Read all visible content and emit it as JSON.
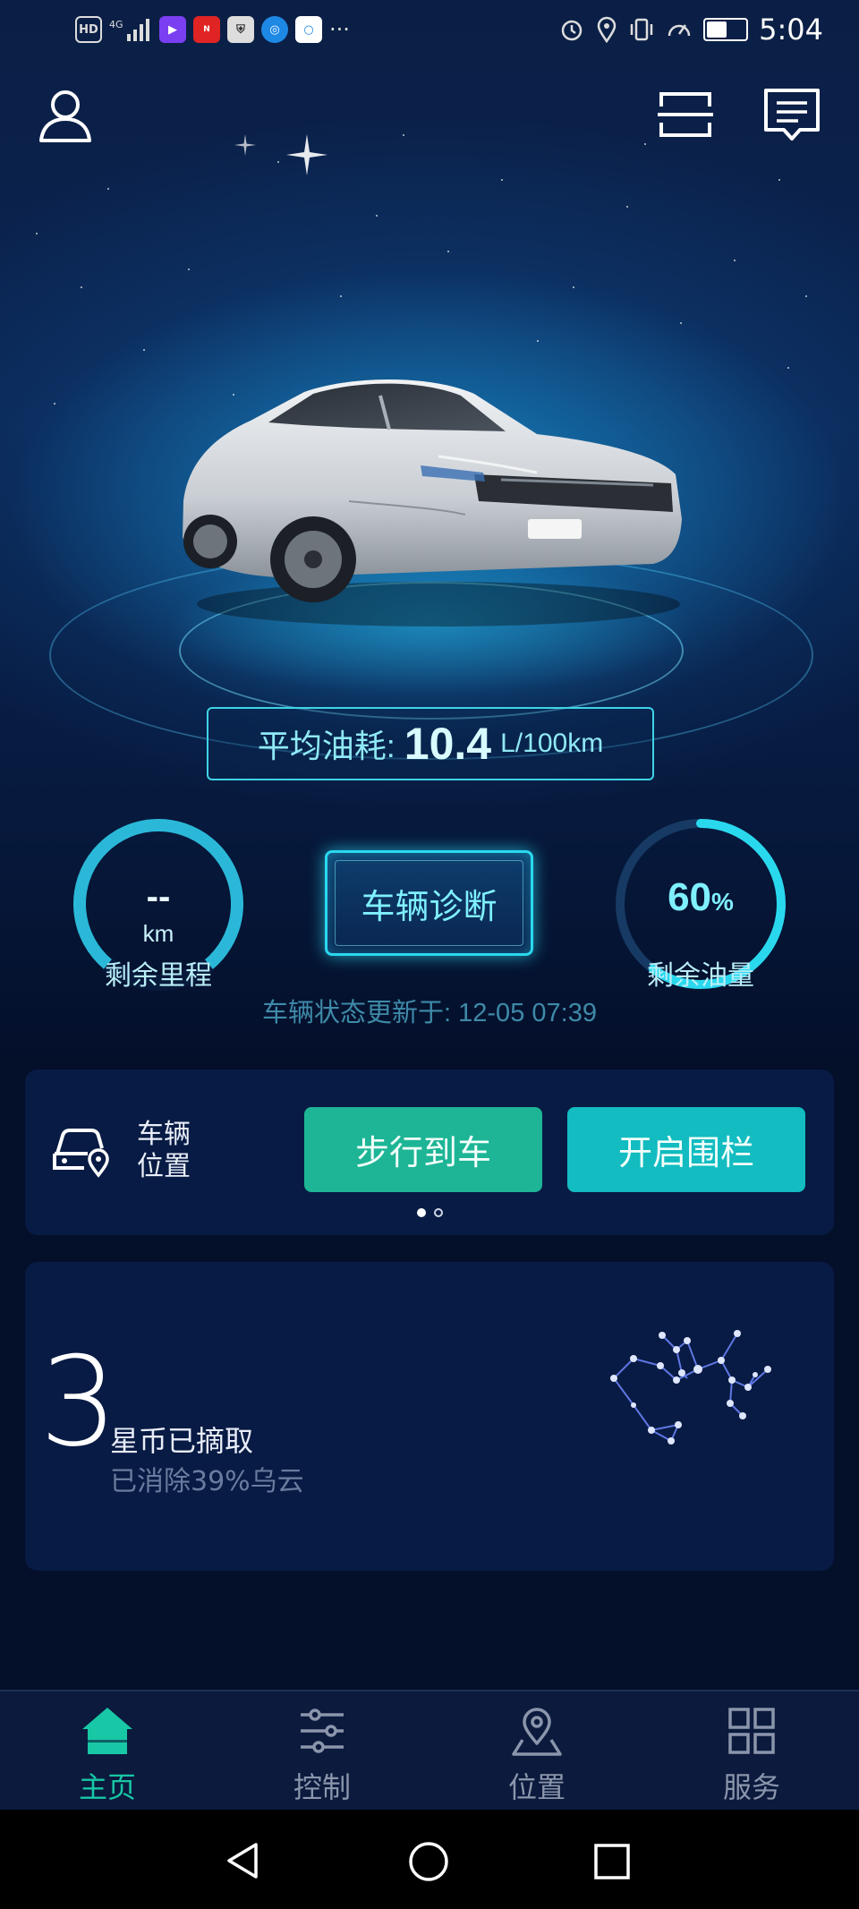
{
  "status_bar": {
    "left_icons": [
      "hd-icon",
      "4g-signal-icon",
      "video-app-icon",
      "news-app-icon",
      "shield-app-icon",
      "browser-app-icon",
      "search-app-icon",
      "more-dots-icon"
    ],
    "more": "···",
    "time": "5:04",
    "battery_level": 0.55
  },
  "header": {
    "profile_icon": "user-icon",
    "scan_icon": "scan-icon",
    "message_icon": "message-icon"
  },
  "fuel": {
    "label": "平均油耗:",
    "value": "10.4",
    "unit": "L/100km"
  },
  "range_gauge": {
    "value": "--",
    "unit": "km",
    "caption": "剩余里程"
  },
  "diagnosis_button": "车辆诊断",
  "fuel_gauge": {
    "value": "60",
    "unit": "%",
    "caption": "剩余油量",
    "level": 0.6
  },
  "update_time": "车辆状态更新于: 12-05 07:39",
  "location_card": {
    "label_line1": "车辆",
    "label_line2": "位置",
    "walk_button": "步行到车",
    "fence_button": "开启围栏",
    "page_count": 2,
    "active_page": 0
  },
  "star_card": {
    "count": "3",
    "coin_text": "星币已摘取",
    "cloud_text": "已消除39%乌云"
  },
  "tabs": [
    {
      "label": "主页",
      "icon": "home-icon",
      "active": true
    },
    {
      "label": "控制",
      "icon": "sliders-icon",
      "active": false
    },
    {
      "label": "位置",
      "icon": "location-icon",
      "active": false
    },
    {
      "label": "服务",
      "icon": "grid-icon",
      "active": false
    }
  ],
  "nav": [
    "back-icon",
    "home-circle-icon",
    "recents-icon"
  ],
  "colors": {
    "accent": "#18c7a5",
    "cyan": "#2ad8ee",
    "background": "#040f2a"
  }
}
